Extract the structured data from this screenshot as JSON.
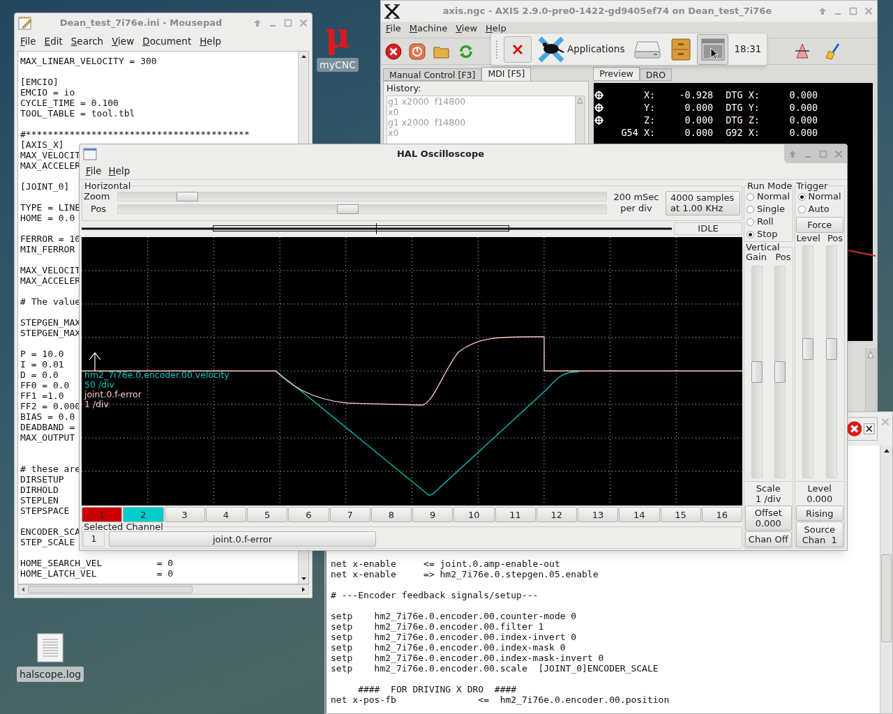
{
  "desktop": {
    "icons": [
      {
        "kind": "logo",
        "glyph": "μ",
        "label": "myCNC"
      },
      {
        "kind": "file",
        "label": "halscope.log"
      }
    ]
  },
  "mousepad": {
    "title": "Dean_test_7i76e.ini - Mousepad",
    "menu": [
      "File",
      "Edit",
      "Search",
      "View",
      "Document",
      "Help"
    ],
    "blocks": [
      [
        "MAX_LINEAR_VELOCITY = 300"
      ],
      [
        "[EMCIO]",
        "EMCIO = io",
        "CYCLE_TIME = 0.100",
        "TOOL_TABLE = tool.tbl"
      ],
      [
        "#*****************************************",
        "[AXIS_X]",
        "MAX_VELOCIT",
        "MAX_ACCELER"
      ],
      [
        "[JOINT_0]"
      ],
      [
        "TYPE = LINE",
        "HOME = 0.0"
      ],
      [
        "FERROR = 10",
        "MIN_FERROR"
      ],
      [
        "MAX_VELOCIT",
        "MAX_ACCELER"
      ],
      [
        "# The value"
      ],
      [
        "STEPGEN_MAX",
        "STEPGEN_MAX"
      ],
      [
        "P = 10.0",
        "I = 0.01",
        "D = 0.0",
        "FF0 = 0.0",
        "FF1 =1.0",
        "FF2 = 0.000",
        "BIAS = 0.0",
        "DEADBAND =",
        "MAX_OUTPUT"
      ],
      [
        "# these are",
        "DIRSETUP",
        "DIRHOLD",
        "STEPLEN",
        "STEPSPACE"
      ],
      [
        "ENCODER_SCA",
        "STEP_SCALE"
      ],
      [
        "HOME_SEARCH_VEL          = 0",
        "HOME_LATCH_VEL           = 0"
      ]
    ]
  },
  "axis": {
    "title": "axis.ngc - AXIS 2.9.0-pre0-1422-gd9405ef74 on Dean_test_7i76e",
    "menu": [
      "File",
      "Machine",
      "View",
      "Help"
    ],
    "left_tabs": [
      {
        "label": "Manual Control [F3]",
        "selected": false
      },
      {
        "label": "MDI [F5]",
        "selected": true
      }
    ],
    "history_label": "History:",
    "history": [
      "g1 x2000  f14800",
      "x0",
      "g1 x2000  f14800",
      "x0"
    ],
    "right_tabs": [
      {
        "label": "Preview",
        "selected": true
      },
      {
        "label": "DRO",
        "selected": false
      }
    ],
    "dro": [
      {
        "homed": true,
        "label": "X:",
        "value": "-0.928",
        "label2": "DTG X:",
        "value2": "0.000"
      },
      {
        "homed": true,
        "label": "Y:",
        "value": "0.000",
        "label2": "DTG Y:",
        "value2": "0.000"
      },
      {
        "homed": true,
        "label": "Z:",
        "value": "0.000",
        "label2": "DTG Z:",
        "value2": "0.000"
      },
      {
        "homed": false,
        "label": "G54 X:",
        "value": "0.000",
        "label2": "G92 X:",
        "value2": "0.000"
      }
    ]
  },
  "panel": {
    "launcher": "Applications",
    "clock": "18:31"
  },
  "hal_editor": {
    "blocks": [
      [
        "net x-enable     <= joint.0.amp-enable-out",
        "net x-enable     => hm2_7i76e.0.stepgen.05.enable"
      ],
      [
        "# ---Encoder feedback signals/setup---"
      ],
      [
        "setp    hm2_7i76e.0.encoder.00.counter-mode 0",
        "setp    hm2_7i76e.0.encoder.00.filter 1",
        "setp    hm2_7i76e.0.encoder.00.index-invert 0",
        "setp    hm2_7i76e.0.encoder.00.index-mask 0",
        "setp    hm2_7i76e.0.encoder.00.index-mask-invert 0",
        "setp    hm2_7i76e.0.encoder.00.scale  [JOINT_0]ENCODER_SCALE"
      ],
      [
        "     ####  FOR DRIVING X DRO  ####",
        "net x-pos-fb               <=  hm2_7i76e.0.encoder.00.position"
      ]
    ]
  },
  "scope": {
    "title": "HAL Oscilloscope",
    "menu": [
      "File",
      "Help"
    ],
    "horizontal": {
      "label": "Horizontal",
      "zoom_label": "Zoom",
      "zoom": {
        "level": 0.125
      },
      "pos_label": "Pos",
      "pos": {
        "level": 0.47
      },
      "rate": [
        "200 mSec",
        "per div"
      ],
      "samples_button": [
        "4000 samples",
        "at 1.00 KHz"
      ]
    },
    "status": "IDLE",
    "traces": [
      {
        "name": "hm2_7i76e.0.encoder.00.velocity",
        "scale": "50 /div",
        "color": "#00c8c8"
      },
      {
        "name": "joint.0.f-error",
        "scale": "1 /div",
        "color": "#ffc8c8"
      }
    ],
    "channels": [
      {
        "label": "1",
        "color": "#cc0000"
      },
      {
        "label": "2",
        "color": "#00cccc"
      },
      {
        "label": "3"
      },
      {
        "label": "4"
      },
      {
        "label": "5"
      },
      {
        "label": "6"
      },
      {
        "label": "7"
      },
      {
        "label": "8"
      },
      {
        "label": "9"
      },
      {
        "label": "10"
      },
      {
        "label": "11"
      },
      {
        "label": "12"
      },
      {
        "label": "13"
      },
      {
        "label": "14"
      },
      {
        "label": "15"
      },
      {
        "label": "16"
      }
    ],
    "selected_channel": {
      "label": "Selected Channel",
      "number": "1",
      "name": "joint.0.f-error"
    },
    "run_mode": {
      "label": "Run Mode",
      "options": [
        {
          "label": "Normal",
          "selected": false
        },
        {
          "label": "Single",
          "selected": false
        },
        {
          "label": "Roll",
          "selected": false
        },
        {
          "label": "Stop",
          "selected": true
        }
      ]
    },
    "vertical": {
      "label": "Vertical",
      "gain_label": "Gain",
      "gain": {
        "level": 0.5
      },
      "pos_label": "Pos",
      "pos": {
        "level": 0.5
      },
      "scale": [
        "Scale",
        "1 /div"
      ],
      "offset_button": [
        "Offset",
        "0.000"
      ],
      "chan_off_button": "Chan Off"
    },
    "trigger": {
      "label": "Trigger",
      "options": [
        {
          "label": "Normal",
          "selected": true
        },
        {
          "label": "Auto",
          "selected": false
        }
      ],
      "force_button": "Force",
      "level_label": "Level",
      "level": {
        "level": 0.56
      },
      "pos_label": "Pos",
      "pos": {
        "level": 0.56
      },
      "readout": [
        "Level",
        "0.000"
      ],
      "edge_button": "Rising",
      "source_button": [
        "Source",
        "Chan  1"
      ]
    }
  }
}
